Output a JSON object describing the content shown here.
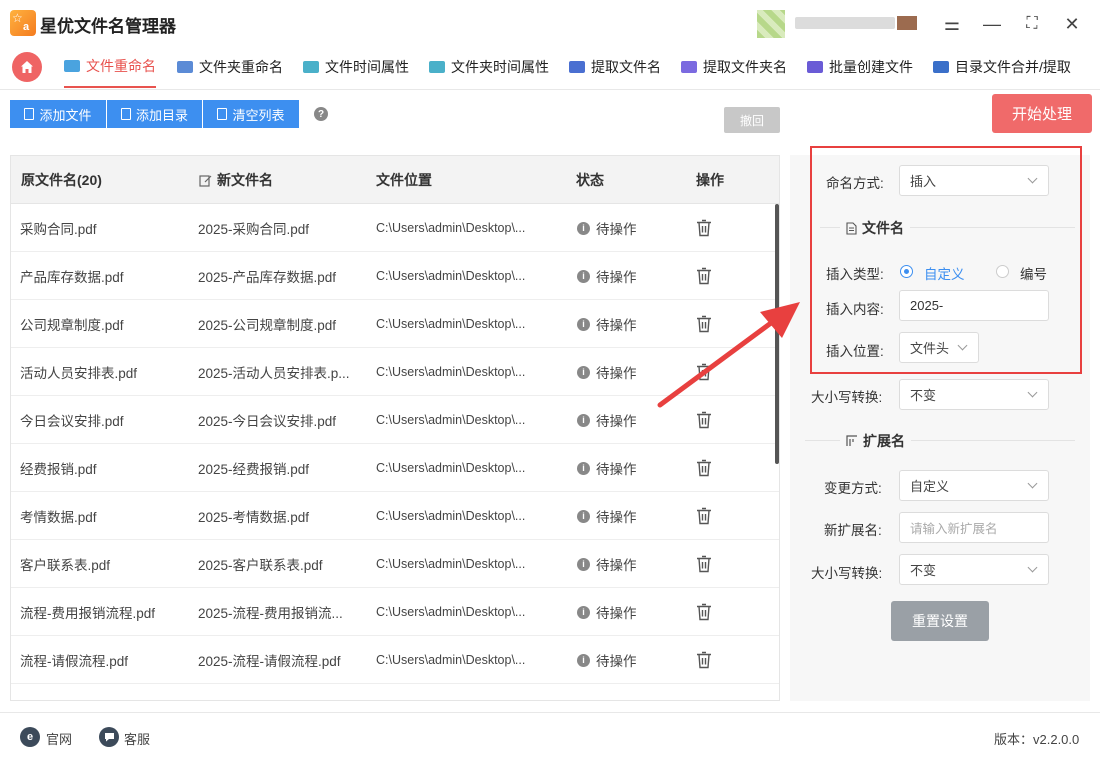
{
  "app": {
    "title": "星优文件名管理器",
    "logo_letters": "a"
  },
  "window": {
    "settings": "⚌",
    "minimize": "—",
    "maximize": "⛶",
    "close": "✕"
  },
  "tabs": [
    {
      "label": "文件重命名",
      "active": true,
      "icon_color": "#4aa3df"
    },
    {
      "label": "文件夹重命名",
      "active": false,
      "icon_color": "#5b8bd6"
    },
    {
      "label": "文件时间属性",
      "active": false,
      "icon_color": "#4ab0c9"
    },
    {
      "label": "文件夹时间属性",
      "active": false,
      "icon_color": "#4ab0c9"
    },
    {
      "label": "提取文件名",
      "active": false,
      "icon_color": "#4a6fd1"
    },
    {
      "label": "提取文件夹名",
      "active": false,
      "icon_color": "#7b6ae0"
    },
    {
      "label": "批量创建文件",
      "active": false,
      "icon_color": "#6a5bd6"
    },
    {
      "label": "目录文件合并/提取",
      "active": false,
      "icon_color": "#3a6fc9"
    }
  ],
  "toolbar": {
    "add_file": "添加文件",
    "add_dir": "添加目录",
    "clear_list": "清空列表",
    "help": "?",
    "undo": "撤回",
    "start": "开始处理"
  },
  "table": {
    "headers": {
      "orig": "原文件名(20)",
      "new": "新文件名",
      "location": "文件位置",
      "status": "状态",
      "action": "操作"
    },
    "rows": [
      {
        "orig": "采购合同.pdf",
        "new": "2025-采购合同.pdf",
        "location": "C:\\Users\\admin\\Desktop\\...",
        "status": "待操作"
      },
      {
        "orig": "产品库存数据.pdf",
        "new": "2025-产品库存数据.pdf",
        "location": "C:\\Users\\admin\\Desktop\\...",
        "status": "待操作"
      },
      {
        "orig": "公司规章制度.pdf",
        "new": "2025-公司规章制度.pdf",
        "location": "C:\\Users\\admin\\Desktop\\...",
        "status": "待操作"
      },
      {
        "orig": "活动人员安排表.pdf",
        "new": "2025-活动人员安排表.p...",
        "location": "C:\\Users\\admin\\Desktop\\...",
        "status": "待操作"
      },
      {
        "orig": "今日会议安排.pdf",
        "new": "2025-今日会议安排.pdf",
        "location": "C:\\Users\\admin\\Desktop\\...",
        "status": "待操作"
      },
      {
        "orig": "经费报销.pdf",
        "new": "2025-经费报销.pdf",
        "location": "C:\\Users\\admin\\Desktop\\...",
        "status": "待操作"
      },
      {
        "orig": "考情数据.pdf",
        "new": "2025-考情数据.pdf",
        "location": "C:\\Users\\admin\\Desktop\\...",
        "status": "待操作"
      },
      {
        "orig": "客户联系表.pdf",
        "new": "2025-客户联系表.pdf",
        "location": "C:\\Users\\admin\\Desktop\\...",
        "status": "待操作"
      },
      {
        "orig": "流程-费用报销流程.pdf",
        "new": "2025-流程-费用报销流...",
        "location": "C:\\Users\\admin\\Desktop\\...",
        "status": "待操作"
      },
      {
        "orig": "流程-请假流程.pdf",
        "new": "2025-流程-请假流程.pdf",
        "location": "C:\\Users\\admin\\Desktop\\...",
        "status": "待操作"
      }
    ]
  },
  "panel": {
    "naming_label": "命名方式:",
    "naming_value": "插入",
    "filename_section": "文件名",
    "insert_type_label": "插入类型:",
    "insert_type_custom": "自定义",
    "insert_type_number": "编号",
    "insert_content_label": "插入内容:",
    "insert_content_value": "2025-",
    "insert_pos_label": "插入位置:",
    "insert_pos_value": "文件头",
    "case_label": "大小写转换:",
    "case_value": "不变",
    "ext_section": "扩展名",
    "ext_mode_label": "变更方式:",
    "ext_mode_value": "自定义",
    "new_ext_label": "新扩展名:",
    "new_ext_placeholder": "请输入新扩展名",
    "ext_case_label": "大小写转换:",
    "ext_case_value": "不变",
    "reset": "重置设置"
  },
  "footer": {
    "website": "官网",
    "website_icon": "e",
    "support": "客服",
    "version": "版本：v2.2.0.0"
  },
  "colors": {
    "accent": "#e8534f",
    "primary": "#3d8ff0",
    "highlight": "#e8403f"
  }
}
